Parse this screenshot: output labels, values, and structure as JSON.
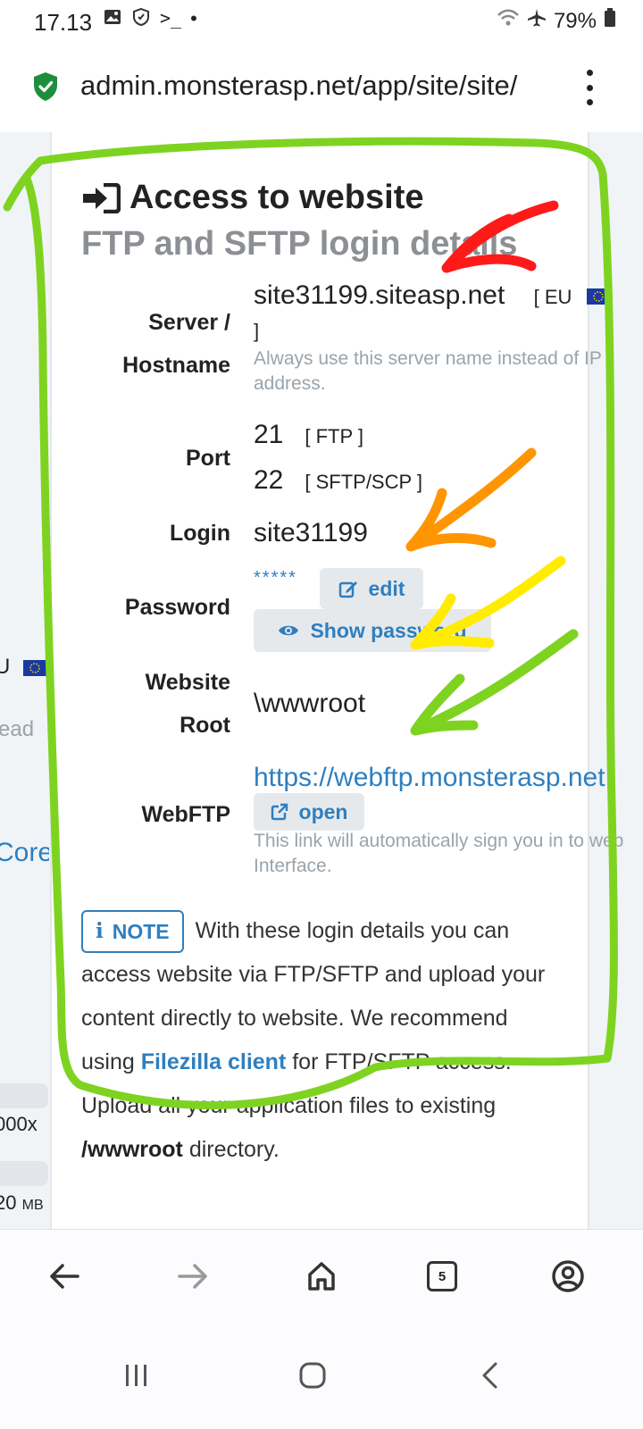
{
  "status_bar": {
    "time": "17.13",
    "battery": "79%",
    "icons": [
      "image-icon",
      "shield-hand-icon",
      "terminal-icon",
      "dot-icon",
      "wifi-icon",
      "airplane-icon",
      "battery-icon"
    ]
  },
  "browser": {
    "url": "admin.monsterasp.net/app/site/site/",
    "tab_count": "5"
  },
  "left_column": {
    "eu_fragment": "U",
    "help_fragment": "ead",
    "link_fragment": "Core",
    "size1": "000x",
    "size2_value": "20",
    "size2_unit": "MB"
  },
  "card": {
    "title": "Access to website",
    "subtitle": "FTP and SFTP login details",
    "server_label_line1": "Server /",
    "server_label_line2": "Hostname",
    "server_value": "site31199.siteasp.net",
    "server_region_open": "[ EU",
    "server_region_close": "]",
    "server_help": "Always use this server name instead of IP address.",
    "port_label": "Port",
    "ports": [
      {
        "number": "21",
        "protocol": "[ FTP ]"
      },
      {
        "number": "22",
        "protocol": "[ SFTP/SCP ]"
      }
    ],
    "login_label": "Login",
    "login_value": "site31199",
    "password_label": "Password",
    "password_masked": "*****",
    "edit_button": "edit",
    "show_password_button": "Show password",
    "website_root_label_line1": "Website",
    "website_root_label_line2": "Root",
    "website_root_value": "\\wwwroot",
    "webftp_label": "WebFTP",
    "webftp_url": "https://webftp.monsterasp.net",
    "open_button": "open",
    "webftp_help": "This link will automatically sign you in to web Interface.",
    "note_badge": "NOTE",
    "note_text_1": "With these login details you can access website via FTP/SFTP and upload your content directly to website. We recommend using",
    "note_link": "Filezilla client",
    "note_text_2": "for FTP/SFTP access. Upload all your application files to existing",
    "note_bold": "/wwwroot",
    "note_text_3": "directory."
  },
  "colors": {
    "accent_blue": "#2e7fc0",
    "annotation_green": "#7ed321",
    "annotation_red": "#ff1a1a",
    "annotation_orange": "#ff9500",
    "annotation_yellow": "#ffec00"
  }
}
